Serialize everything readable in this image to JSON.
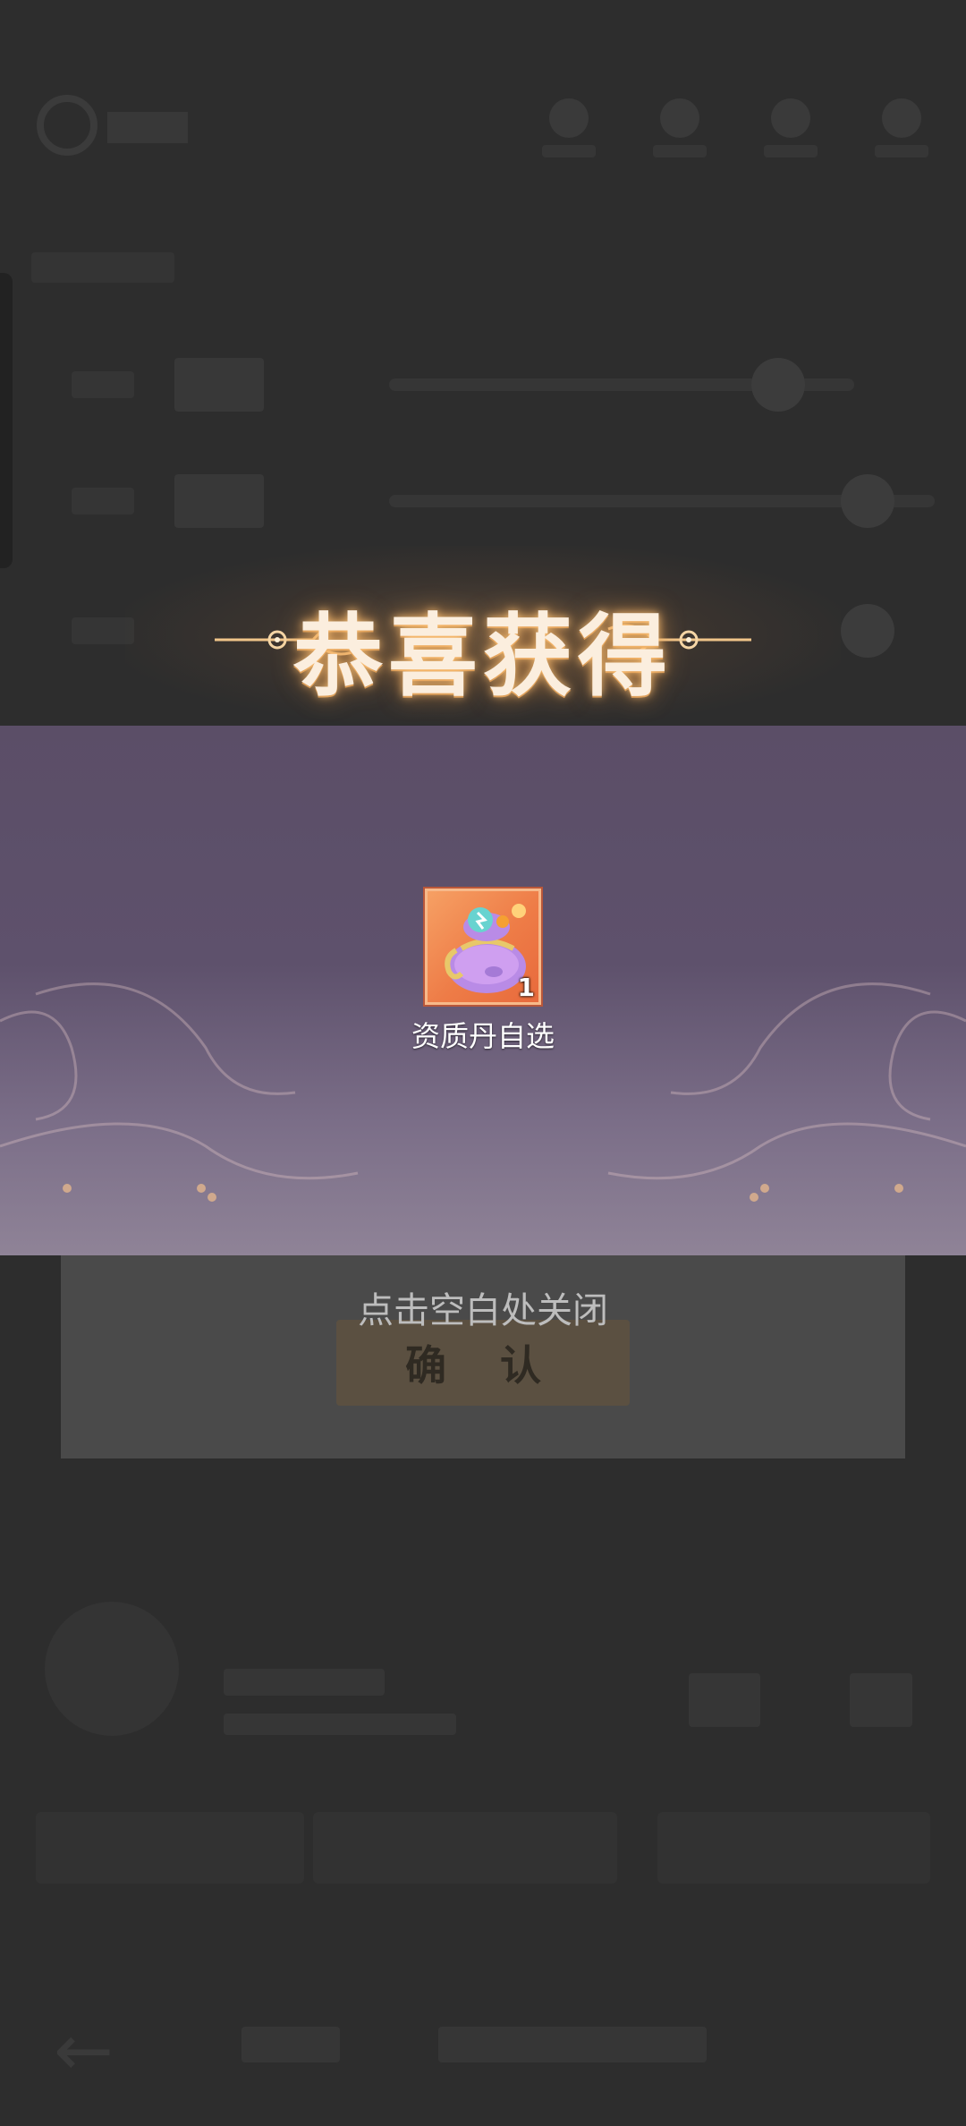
{
  "background": {
    "confirm_button_label": "确 认"
  },
  "popup": {
    "title": "恭喜获得",
    "items": [
      {
        "name": "资质丹自选",
        "count": "1",
        "icon": "purple-pouch-icon"
      }
    ],
    "close_hint": "点击空白处关闭"
  },
  "colors": {
    "panel": "#5e516c",
    "item_frame": "#ee7c47",
    "title_glow": "#e6964a"
  }
}
